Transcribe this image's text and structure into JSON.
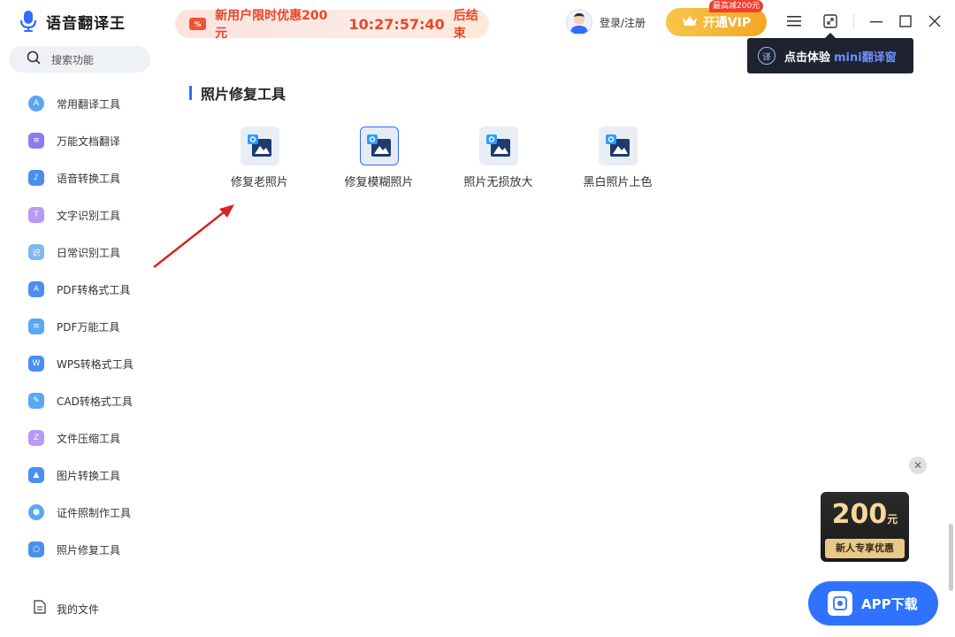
{
  "app": {
    "title": "语音翻译王"
  },
  "promo": {
    "text": "新用户限时优惠200元",
    "timer": "10:27:57:40",
    "suffix": "后结束"
  },
  "header": {
    "login_label": "登录/注册",
    "vip_label": "开通VIP",
    "vip_badge": "最高减200元",
    "icons": [
      "menu-icon",
      "mini-window-icon",
      "minimize-icon",
      "maximize-icon",
      "close-icon"
    ]
  },
  "tooltip": {
    "text": "点击体验",
    "accent": "mini翻译窗",
    "icon": "译"
  },
  "search": {
    "placeholder": "搜索功能"
  },
  "sidebar": {
    "items": [
      {
        "label": "常用翻译工具",
        "icon": "translate-icon",
        "glyph": "A",
        "color": "#5aa7f5"
      },
      {
        "label": "万能文档翻译",
        "icon": "document-icon",
        "glyph": "≡",
        "color": "#8b7bf0"
      },
      {
        "label": "语音转换工具",
        "icon": "audio-icon",
        "glyph": "♪",
        "color": "#4a8ff0"
      },
      {
        "label": "文字识别工具",
        "icon": "text-ocr-icon",
        "glyph": "T",
        "color": "#b69af5"
      },
      {
        "label": "日常识别工具",
        "icon": "recognize-icon",
        "glyph": "识",
        "color": "#7fb8f0"
      },
      {
        "label": "PDF转格式工具",
        "icon": "pdf-convert-icon",
        "glyph": "A",
        "color": "#4a8ff0"
      },
      {
        "label": "PDF万能工具",
        "icon": "pdf-tools-icon",
        "glyph": "≡",
        "color": "#5aa7f5"
      },
      {
        "label": "WPS转格式工具",
        "icon": "wps-icon",
        "glyph": "W",
        "color": "#4a8ff0"
      },
      {
        "label": "CAD转格式工具",
        "icon": "cad-icon",
        "glyph": "✎",
        "color": "#5aa7f5"
      },
      {
        "label": "文件压缩工具",
        "icon": "compress-icon",
        "glyph": "Z",
        "color": "#b69af5"
      },
      {
        "label": "图片转换工具",
        "icon": "image-convert-icon",
        "glyph": "▲",
        "color": "#4a8ff0"
      },
      {
        "label": "证件照制作工具",
        "icon": "id-photo-icon",
        "glyph": "●",
        "color": "#5aa7f5"
      },
      {
        "label": "照片修复工具",
        "icon": "photo-repair-icon",
        "glyph": "○",
        "color": "#4a8ff0"
      }
    ],
    "my_files": "我的文件"
  },
  "main": {
    "section_title": "照片修复工具",
    "tools": [
      {
        "label": "修复老照片",
        "icon": "photo-repair-icon",
        "active": false
      },
      {
        "label": "修复模糊照片",
        "icon": "photo-deblur-icon",
        "active": true
      },
      {
        "label": "照片无损放大",
        "icon": "photo-upscale-icon",
        "active": false
      },
      {
        "label": "黑白照片上色",
        "icon": "photo-colorize-icon",
        "active": false
      }
    ]
  },
  "ads": {
    "coupon_amount": "200",
    "coupon_unit": "元",
    "coupon_desc": "新人专享优惠",
    "app_download": "APP下载"
  },
  "colors": {
    "accent": "#2f6bff",
    "promo": "#e8472b",
    "vip": "#f5a623"
  }
}
